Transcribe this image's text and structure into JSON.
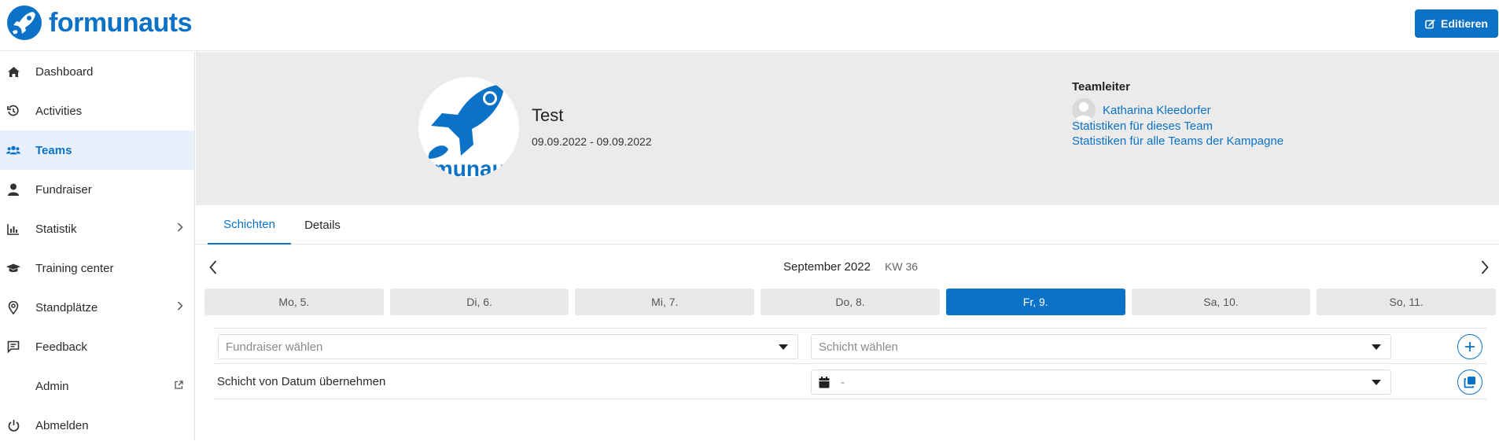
{
  "app": {
    "brand_name": "formunauts",
    "accent_color": "#0b72c7",
    "edit_button_label": "Editieren"
  },
  "sidebar": {
    "items": [
      {
        "label": "Dashboard",
        "icon": "home-icon"
      },
      {
        "label": "Activities",
        "icon": "history-icon"
      },
      {
        "label": "Teams",
        "icon": "users-icon",
        "active": true
      },
      {
        "label": "Fundraiser",
        "icon": "user-icon"
      },
      {
        "label": "Statistik",
        "icon": "bar-chart-icon",
        "chevron": true
      },
      {
        "label": "Training center",
        "icon": "graduation-cap-icon"
      },
      {
        "label": "Standplätze",
        "icon": "map-pin-icon",
        "chevron": true
      },
      {
        "label": "Feedback",
        "icon": "message-icon"
      },
      {
        "label": "Admin",
        "icon": "external-link-icon"
      },
      {
        "label": "Abmelden",
        "icon": "power-icon"
      }
    ]
  },
  "team": {
    "name": "Test",
    "dates": "09.09.2022 - 09.09.2022",
    "logo_text": "rmunaut"
  },
  "leader": {
    "title": "Teamleiter",
    "name": "Katharina Kleedorfer"
  },
  "links": {
    "stats_team": "Statistiken für dieses Team",
    "stats_all": "Statistiken für alle Teams der Kampagne"
  },
  "tabs": [
    {
      "label": "Schichten",
      "active": true
    },
    {
      "label": "Details",
      "active": false
    }
  ],
  "week": {
    "month": "September 2022",
    "kw": "KW 36",
    "days": [
      {
        "label": "Mo, 5.",
        "active": false
      },
      {
        "label": "Di, 6.",
        "active": false
      },
      {
        "label": "Mi, 7.",
        "active": false
      },
      {
        "label": "Do, 8.",
        "active": false
      },
      {
        "label": "Fr, 9.",
        "active": true
      },
      {
        "label": "Sa, 10.",
        "active": false
      },
      {
        "label": "So, 11.",
        "active": false
      }
    ]
  },
  "form": {
    "fundraiser_placeholder": "Fundraiser wählen",
    "shift_placeholder": "Schicht wählen",
    "copy_label": "Schicht von Datum übernehmen",
    "date_value": "-"
  }
}
